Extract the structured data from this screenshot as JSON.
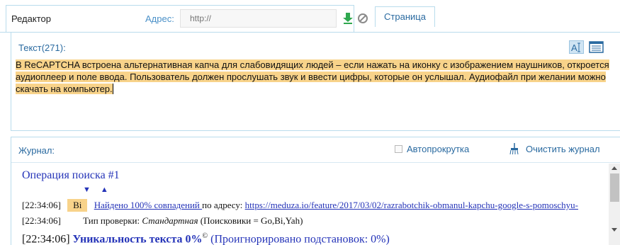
{
  "tabs": {
    "editor_label": "Редактор",
    "page_label": "Страница"
  },
  "address": {
    "label": "Адрес:",
    "placeholder": "http://"
  },
  "editor": {
    "label": "Текст(271):",
    "text": "В ReCAPTCHA встроена альтернативная капча для слабовидящих людей – если нажать на иконку с изображением наушников, откроется аудиоплеер и поле ввода. Пользователь должен прослушать звук и ввести цифры, которые он услышал. Аудиофайл при желании можно скачать на компьютер."
  },
  "journal": {
    "label": "Журнал:",
    "autoscroll_label": "Автопрокрутка",
    "clear_label": "Очистить журнал",
    "operation_title": "Операция поиска #1",
    "entries": [
      {
        "time": "[22:34:06]",
        "engine": "Bi",
        "found_text": "Найдено 100% совпадений ",
        "mid_text": "по адресу: ",
        "url": "https://meduza.io/feature/2017/03/02/razrabotchik-obmanul-kapchu-google-s-pomoschyu-"
      },
      {
        "time": "[22:34:06]",
        "type_label": "Тип проверки: ",
        "type_value": "Стандартная",
        "type_rest": " (Поисковики = Go,Bi,Yah)"
      },
      {
        "time": "[22:34:06]",
        "uniqueness": "Уникальность текста 0%",
        "copyright": "©",
        "ignored": "(Проигнорировано подстановок: 0%)"
      }
    ]
  },
  "colors": {
    "accent": "#2a6aa0",
    "border": "#b9dcec",
    "highlight": "#f8d38a",
    "log_link": "#2433b8",
    "download_icon": "#2fa84f"
  },
  "icons": {
    "download": "download-icon",
    "block": "block-icon",
    "font_format": "font-format-icon",
    "list_view": "list-view-icon",
    "broom": "broom-icon",
    "sort_down": "arrow-down-icon",
    "sort_up": "arrow-up-icon"
  }
}
